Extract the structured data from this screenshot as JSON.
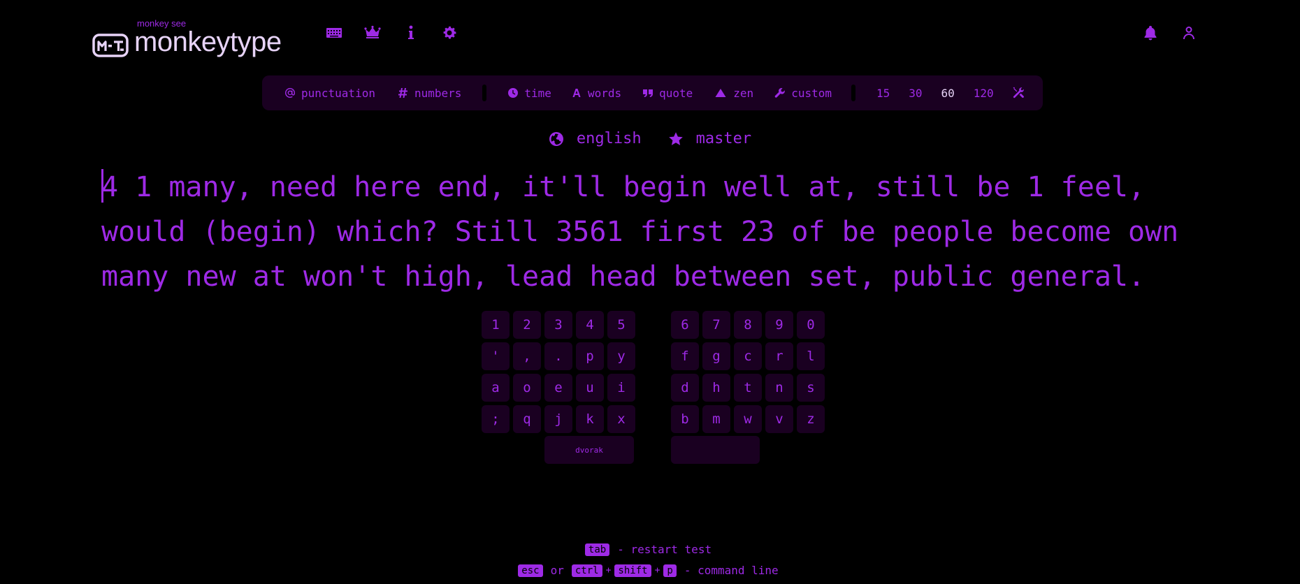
{
  "header": {
    "logo_top": "monkey see",
    "logo_title": "monkeytype",
    "nav": [
      {
        "name": "keyboard-icon",
        "label": "start test"
      },
      {
        "name": "crown-icon",
        "label": "leaderboards"
      },
      {
        "name": "info-icon",
        "label": "about"
      },
      {
        "name": "gear-icon",
        "label": "settings"
      }
    ],
    "nav_right": [
      {
        "name": "bell-icon"
      },
      {
        "name": "user-icon"
      }
    ]
  },
  "config": {
    "punctuation": "punctuation",
    "numbers": "numbers",
    "time": "time",
    "words": "words",
    "quote": "quote",
    "zen": "zen",
    "custom": "custom",
    "durations": [
      "15",
      "30",
      "60",
      "120"
    ],
    "active_duration": "60"
  },
  "test": {
    "language": "english",
    "difficulty": "master",
    "lines": [
      "4 1 many, need here end, it'll begin well at, still be 1 feel,",
      "would (begin) which? Still 3561 first 23 of be people become own",
      "many new at won't high, lead head between set, public general."
    ]
  },
  "keymap": {
    "layout": "dvorak",
    "rows": [
      [
        [
          "1",
          "2",
          "3",
          "4",
          "5"
        ],
        [
          "6",
          "7",
          "8",
          "9",
          "0"
        ]
      ],
      [
        [
          "'",
          ",",
          ".",
          "p",
          "y"
        ],
        [
          "f",
          "g",
          "c",
          "r",
          "l"
        ]
      ],
      [
        [
          "a",
          "o",
          "e",
          "u",
          "i"
        ],
        [
          "d",
          "h",
          "t",
          "n",
          "s"
        ]
      ],
      [
        [
          ";",
          "q",
          "j",
          "k",
          "x"
        ],
        [
          "b",
          "m",
          "w",
          "v",
          "z"
        ]
      ]
    ]
  },
  "footer": {
    "tab_key": "tab",
    "restart_text": "- restart test",
    "esc_key": "esc",
    "or_text": "or",
    "ctrl_key": "ctrl",
    "shift_key": "shift",
    "p_key": "p",
    "plus": "+",
    "command_text": "- command line"
  },
  "colors": {
    "background": "#000000",
    "main": "#9e2ae6",
    "text": "#e7d3f7",
    "sub_alt": "#1a0021"
  }
}
